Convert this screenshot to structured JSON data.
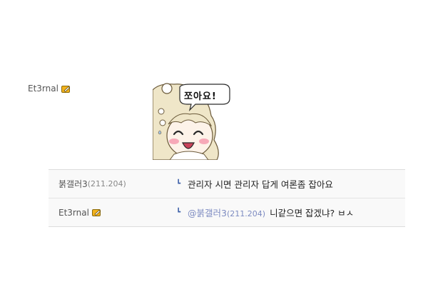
{
  "post": {
    "author": "Et3rnal",
    "author_badge_icon": "gold-pencil-badge-icon",
    "sticker_text": "쪼아요!"
  },
  "replies": [
    {
      "author": "붉갤러3",
      "ip": "(211.204)",
      "arrow": "┗",
      "text": "관리자 시면 관리자 답게 여론좀 잡아요"
    },
    {
      "author": "Et3rnal",
      "author_badge_icon": "gold-pencil-badge-icon",
      "arrow": "┗",
      "mention_name": "@붉갤러3",
      "mention_ip": "(211.204)",
      "text": "니같으면 잡겠냐? ㅂㅅ"
    }
  ],
  "colors": {
    "accent_blue": "#3b5ea8",
    "mention": "#7d8bc1",
    "badge_gold": "#f2b21b",
    "row_bg": "#f9f9f9"
  }
}
